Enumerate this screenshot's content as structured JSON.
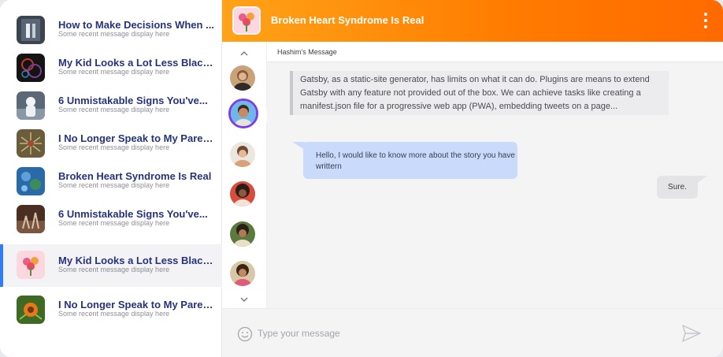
{
  "sidebar": {
    "conversations": [
      {
        "title": "How to Make Decisions When ...",
        "subtitle": "Some recent message display here"
      },
      {
        "title": "My Kid Looks a Lot Less Black...",
        "subtitle": "Some recent message display here"
      },
      {
        "title": "6 Unmistakable Signs You've...",
        "subtitle": "Some recent message display here"
      },
      {
        "title": "I No Longer Speak to My Parent...",
        "subtitle": "Some recent message display here"
      },
      {
        "title": "Broken Heart Syndrome Is Real",
        "subtitle": "Some recent message display here"
      },
      {
        "title": "6 Unmistakable Signs You've...",
        "subtitle": "Some recent message display here"
      },
      {
        "title": "My Kid Looks a Lot Less Black...",
        "subtitle": "Some recent message display here",
        "active": true
      },
      {
        "title": "I No Longer Speak to My Parent...",
        "subtitle": "Some recent message display here"
      }
    ]
  },
  "header": {
    "title": "Broken Heart Syndrome Is Real",
    "menu_icon": "kebab-menu-icon"
  },
  "chat": {
    "context_label": "Hashim's Message",
    "quoted_text": "Gatsby, as a static-site generator, has limits on what it can do. Plugins are means to extend Gatsby with any feature not provided out of the box. We can achieve tasks like creating a manifest.json file for a progressive web app (PWA), embedding tweets on a page...",
    "incoming_message": "Hello, I would like to know more about the story you have writtern",
    "outgoing_message": "Sure."
  },
  "composer": {
    "placeholder": "Type your message",
    "emoji_icon": "smiley-icon",
    "send_icon": "send-icon"
  },
  "colors": {
    "accent": "#2f7df6",
    "header_gradient_start": "#ffa318",
    "header_gradient_end": "#ff6a00",
    "title_text": "#26337a",
    "incoming_bubble": "#c9dafb"
  }
}
